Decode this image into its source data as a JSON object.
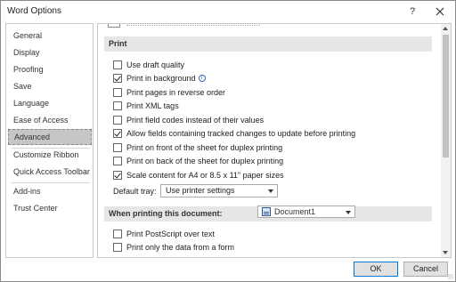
{
  "window": {
    "title": "Word Options",
    "help_label": "?",
    "close_label": "✕"
  },
  "sidebar": {
    "items": [
      {
        "label": "General"
      },
      {
        "label": "Display"
      },
      {
        "label": "Proofing"
      },
      {
        "label": "Save"
      },
      {
        "label": "Language"
      },
      {
        "label": "Ease of Access"
      },
      {
        "label": "Advanced"
      },
      {
        "label": "Customize Ribbon"
      },
      {
        "label": "Quick Access Toolbar"
      },
      {
        "label": "Add-ins"
      },
      {
        "label": "Trust Center"
      }
    ],
    "selected": "Advanced"
  },
  "print_section": {
    "header": "Print",
    "options": [
      {
        "label": "Use draft quality",
        "checked": false
      },
      {
        "label": "Print in background",
        "checked": true
      },
      {
        "label": "Print pages in reverse order",
        "checked": false
      },
      {
        "label": "Print XML tags",
        "checked": false
      },
      {
        "label": "Print field codes instead of their values",
        "checked": false
      },
      {
        "label": "Allow fields containing tracked changes to update before printing",
        "checked": true
      },
      {
        "label": "Print on front of the sheet for duplex printing",
        "checked": false
      },
      {
        "label": "Print on back of the sheet for duplex printing",
        "checked": false
      },
      {
        "label": "Scale content for A4 or 8.5 x 11\" paper sizes",
        "checked": true
      }
    ],
    "default_tray_label": "Default tray:",
    "default_tray_value": "Use printer settings"
  },
  "document_section": {
    "header": "When printing this document:",
    "document_value": "Document1",
    "options": [
      {
        "label": "Print PostScript over text",
        "checked": false
      },
      {
        "label": "Print only the data from a form",
        "checked": false
      }
    ]
  },
  "footer": {
    "ok_label": "OK",
    "cancel_label": "Cancel"
  },
  "colors": {
    "selected_bg": "#c6c6c6",
    "section_header_bg": "#e6e6e6",
    "accent": "#0078d7"
  }
}
